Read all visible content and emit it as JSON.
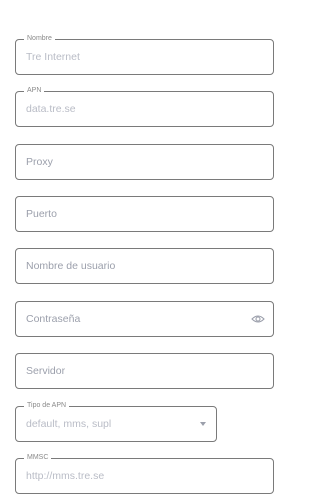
{
  "fields": {
    "name": {
      "label": "Nombre",
      "value": "Tre Internet"
    },
    "apn": {
      "label": "APN",
      "value": "data.tre.se"
    },
    "proxy": {
      "placeholder": "Proxy"
    },
    "port": {
      "placeholder": "Puerto"
    },
    "username": {
      "placeholder": "Nombre de usuario"
    },
    "password": {
      "placeholder": "Contraseña",
      "toggle_icon": "eye-icon"
    },
    "server": {
      "placeholder": "Servidor"
    },
    "apn_type": {
      "label": "Tipo de APN",
      "value": "default, mms, supl",
      "icon": "dropdown-arrow-icon"
    },
    "mmsc": {
      "label": "MMSC",
      "value": "http://mms.tre.se"
    }
  },
  "colors": {
    "border": "#7a7a7a",
    "label": "#8a8a8a",
    "value_text": "#b9bcc6",
    "placeholder_text": "#9b9fab"
  }
}
